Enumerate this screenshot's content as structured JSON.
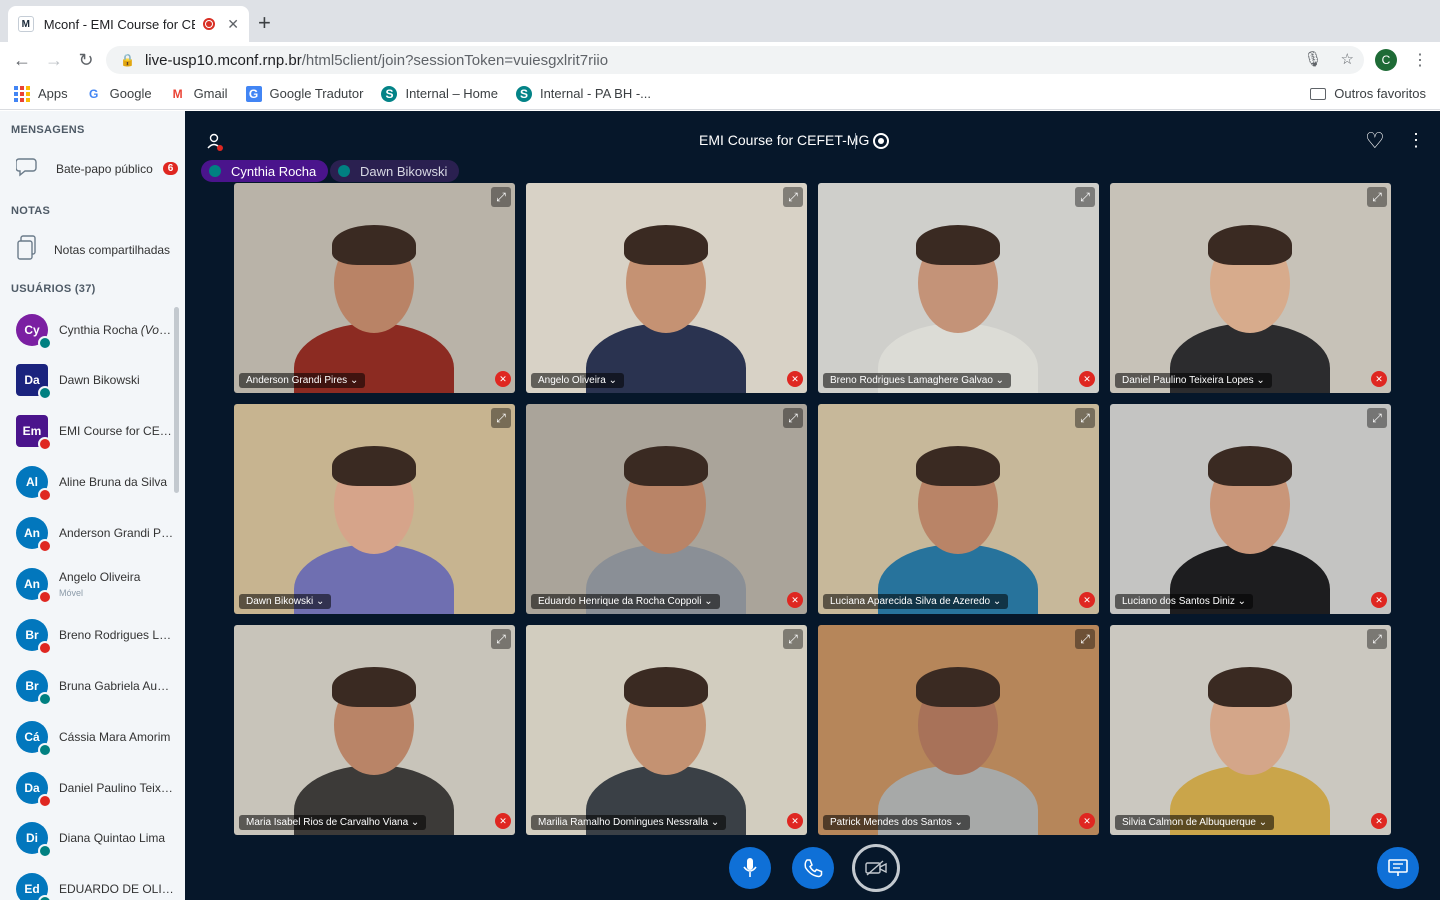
{
  "browser": {
    "tab_title": "Mconf - EMI Course for CEFET-MG",
    "favicon_letter": "M",
    "url_host": "live-usp10.mconf.rnp.br",
    "url_path": "/html5client/join?sessionToken=vuiesgxlrit7riio",
    "profile_initial": "C",
    "bookmarks": [
      {
        "label": "Apps",
        "icon": "apps-grid-icon"
      },
      {
        "label": "Google",
        "icon": "G"
      },
      {
        "label": "Gmail",
        "icon": "M"
      },
      {
        "label": "Google Tradutor",
        "icon": "G"
      },
      {
        "label": "Internal – Home",
        "icon": "S"
      },
      {
        "label": "Internal - PA BH -...",
        "icon": "S"
      }
    ],
    "other_bookmarks": "Outros favoritos"
  },
  "sidebar": {
    "messages_title": "MENSAGENS",
    "public_chat": "Bate-papo público",
    "public_chat_badge": "6",
    "notes_title": "NOTAS",
    "shared_notes": "Notas compartilhadas",
    "users_title": "USUÁRIOS (37)",
    "users": [
      {
        "initials": "Cy",
        "name": "Cynthia Rocha",
        "suffix": "(Você)",
        "color": "#7b1fa2",
        "status": "listen",
        "square": false,
        "sub": ""
      },
      {
        "initials": "Da",
        "name": "Dawn Bikowski",
        "suffix": "",
        "color": "#1a237e",
        "status": "listen",
        "square": true,
        "sub": ""
      },
      {
        "initials": "Em",
        "name": "EMI Course for CEFET-MG",
        "suffix": "",
        "color": "#4a148c",
        "status": "muted",
        "square": true,
        "sub": ""
      },
      {
        "initials": "Al",
        "name": "Aline Bruna da Silva",
        "suffix": "",
        "color": "#0277bd",
        "status": "muted",
        "square": false,
        "sub": ""
      },
      {
        "initials": "An",
        "name": "Anderson Grandi Pires",
        "suffix": "",
        "color": "#0277bd",
        "status": "muted",
        "square": false,
        "sub": ""
      },
      {
        "initials": "An",
        "name": "Angelo Oliveira",
        "suffix": "",
        "color": "#0277bd",
        "status": "muted",
        "square": false,
        "sub": "Móvel"
      },
      {
        "initials": "Br",
        "name": "Breno Rodrigues Lamaghere Galvao",
        "suffix": "",
        "color": "#0277bd",
        "status": "muted",
        "square": false,
        "sub": ""
      },
      {
        "initials": "Br",
        "name": "Bruna Gabriela Augusta",
        "suffix": "",
        "color": "#0277bd",
        "status": "listen",
        "square": false,
        "sub": ""
      },
      {
        "initials": "Cá",
        "name": "Cássia Mara Amorim",
        "suffix": "",
        "color": "#0277bd",
        "status": "listen",
        "square": false,
        "sub": ""
      },
      {
        "initials": "Da",
        "name": "Daniel Paulino Teixeira Lopes",
        "suffix": "",
        "color": "#0277bd",
        "status": "muted",
        "square": false,
        "sub": ""
      },
      {
        "initials": "Di",
        "name": "Diana Quintao Lima",
        "suffix": "",
        "color": "#0277bd",
        "status": "listen",
        "square": false,
        "sub": ""
      },
      {
        "initials": "Ed",
        "name": "EDUARDO DE OLIVEIRA",
        "suffix": "",
        "color": "#0277bd",
        "status": "listen",
        "square": false,
        "sub": ""
      }
    ]
  },
  "main": {
    "meeting_title": "EMI Course for CEFET-MG",
    "talkers": [
      {
        "name": "Cynthia Rocha",
        "active": true
      },
      {
        "name": "Dawn Bikowski",
        "active": false
      }
    ],
    "tiles": [
      {
        "name": "Anderson Grandi Pires",
        "bg": "#b9b3a8",
        "skin": "#b98366",
        "shirt": "#8c2b22",
        "muted": true
      },
      {
        "name": "Angelo Oliveira",
        "bg": "#d8d2c6",
        "skin": "#c59273",
        "shirt": "#2a3350",
        "muted": true
      },
      {
        "name": "Breno Rodrigues Lamaghere Galvao",
        "bg": "#cfcfcb",
        "skin": "#c49378",
        "shirt": "#dcdcd6",
        "muted": true
      },
      {
        "name": "Daniel Paulino Teixeira Lopes",
        "bg": "#c7c2b8",
        "skin": "#d7ab8c",
        "shirt": "#2c2c2e",
        "muted": true
      },
      {
        "name": "Dawn Bikowski",
        "bg": "#c7b490",
        "skin": "#d6a48a",
        "shirt": "#6f6fb1",
        "muted": false
      },
      {
        "name": "Eduardo Henrique da Rocha Coppoli",
        "bg": "#aaa49a",
        "skin": "#b98467",
        "shirt": "#8a8f96",
        "muted": true
      },
      {
        "name": "Luciana Aparecida Silva de Azeredo",
        "bg": "#c7b89a",
        "skin": "#b98467",
        "shirt": "#27739c",
        "muted": true
      },
      {
        "name": "Luciano dos Santos Diniz",
        "bg": "#c4c4c2",
        "skin": "#c99679",
        "shirt": "#1d1d1f",
        "muted": true
      },
      {
        "name": "Maria Isabel Rios de Carvalho Viana",
        "bg": "#c8c4ba",
        "skin": "#b98467",
        "shirt": "#3c3a38",
        "muted": true
      },
      {
        "name": "Marilia Ramalho Domingues Nessralla",
        "bg": "#d2cdbf",
        "skin": "#c49272",
        "shirt": "#3a4046",
        "muted": true
      },
      {
        "name": "Patrick Mendes dos Santos",
        "bg": "#b6865a",
        "skin": "#a87259",
        "shirt": "#a7a9a8",
        "muted": true
      },
      {
        "name": "Silvia Calmon de Albuquerque",
        "bg": "#cbc8c0",
        "skin": "#d4a689",
        "shirt": "#caa54a",
        "muted": true
      }
    ]
  }
}
